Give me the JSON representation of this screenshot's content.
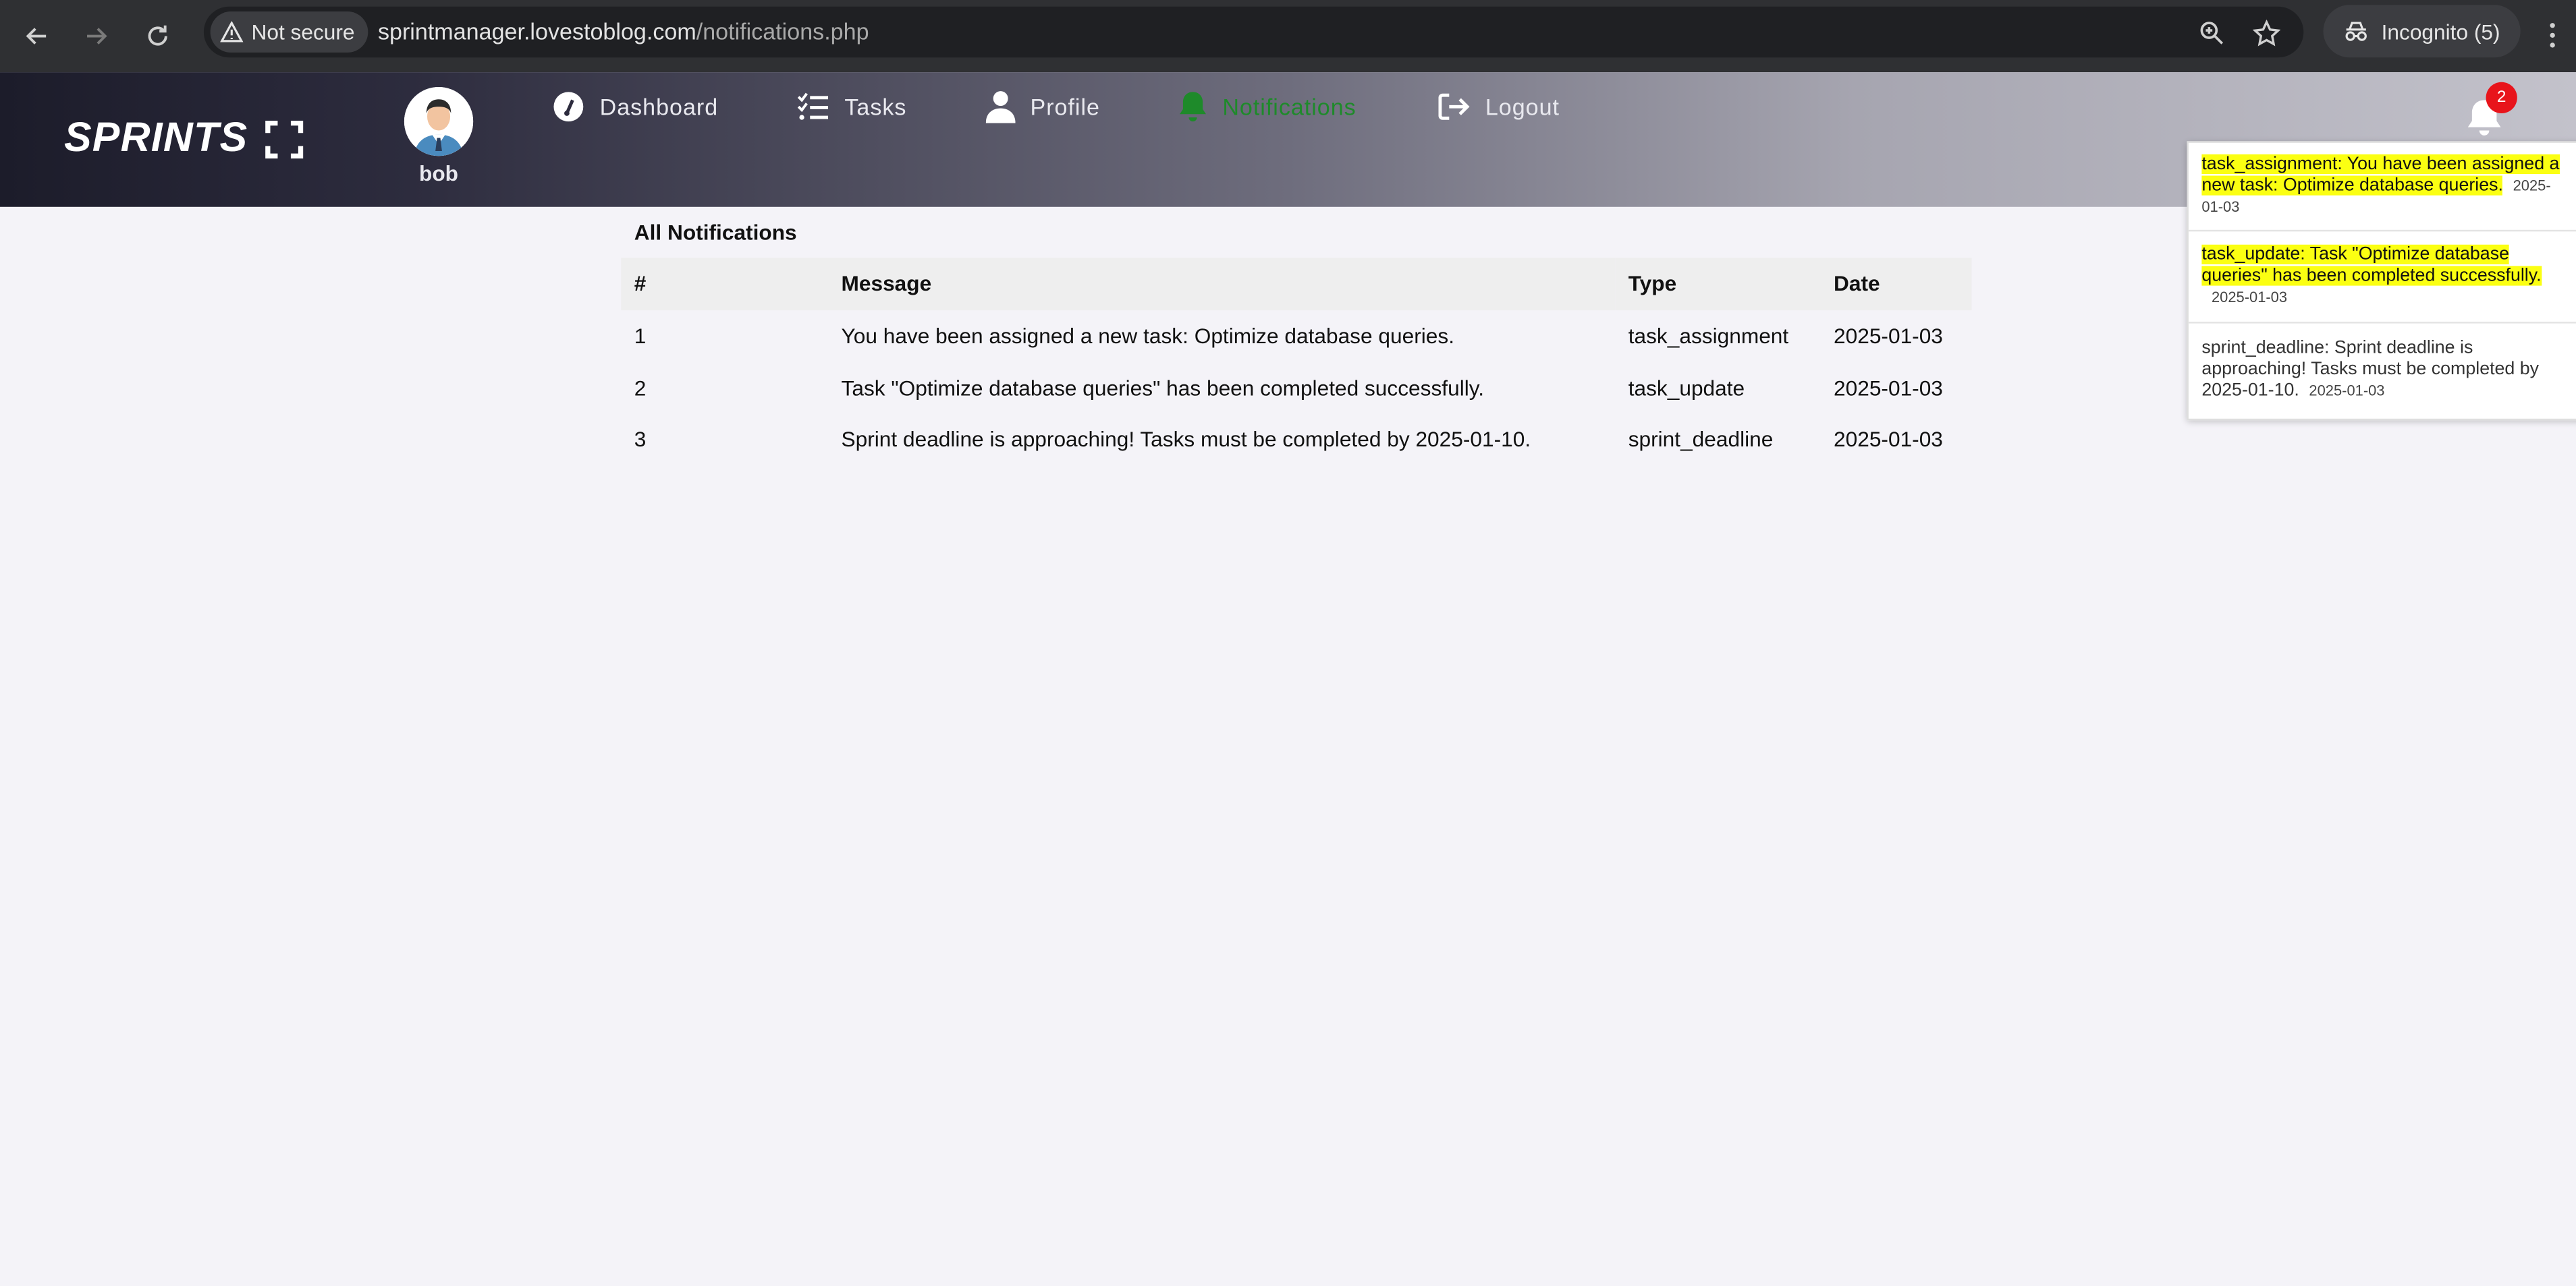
{
  "browser": {
    "security_label": "Not secure",
    "url_host": "sprintmanager.lovestoblog.com",
    "url_path": "/notifications.php",
    "incognito_label": "Incognito (5)"
  },
  "header": {
    "logo_text": "SPRINTS",
    "username": "bob",
    "nav": {
      "dashboard": "Dashboard",
      "tasks": "Tasks",
      "profile": "Profile",
      "notifications": "Notifications",
      "logout": "Logout"
    },
    "active_nav": "notifications",
    "active_color": "#1e8a2a",
    "badge_count": "2",
    "badge_color": "#e8141b"
  },
  "main": {
    "title": "All Notifications",
    "columns": [
      "#",
      "Message",
      "Type",
      "Date"
    ],
    "rows": [
      [
        "1",
        "You have been assigned a new task: Optimize database queries.",
        "task_assignment",
        "2025-01-03"
      ],
      [
        "2",
        "Task \"Optimize database queries\" has been completed successfully.",
        "task_update",
        "2025-01-03"
      ],
      [
        "3",
        "Sprint deadline is approaching! Tasks must be completed by 2025-01-10.",
        "sprint_deadline",
        "2025-01-03"
      ]
    ]
  },
  "dropdown": {
    "items": [
      {
        "line1": "task_assignment: You have been assigned a",
        "line2": "new task: Optimize database queries.",
        "date_a": "2025-",
        "date_b": "01-03",
        "unread": true
      },
      {
        "line1": "task_update: Task \"Optimize database",
        "line2": "queries\" has been completed successfully.",
        "date": "2025-01-03",
        "unread": true
      },
      {
        "line1": "sprint_deadline: Sprint deadline is",
        "line2": "approaching! Tasks must be completed by",
        "line3": "2025-01-10.",
        "date": "2025-01-03",
        "unread": false
      }
    ],
    "highlight_color": "#fbff12"
  }
}
